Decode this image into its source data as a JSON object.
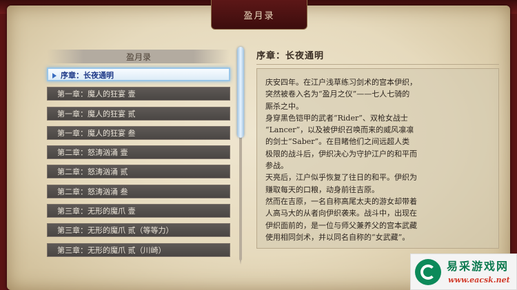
{
  "window": {
    "title": "盈月录"
  },
  "left_panel": {
    "header": "盈月录",
    "selected_index": 0,
    "chapters": [
      "序章：长夜通明",
      "第一章：魔人的狂宴  壹",
      "第一章：魔人的狂宴  贰",
      "第一章：魔人的狂宴  叁",
      "第二章：怒涛汹涌  壹",
      "第二章：怒涛汹涌  贰",
      "第二章：怒涛汹涌  叁",
      "第三章：无形的魔爪  壹",
      "第三章：无形的魔爪  贰（等等力）",
      "第三章：无形的魔爪  贰（川崎）"
    ]
  },
  "scrollbar": {
    "position": 0.0
  },
  "right_panel": {
    "title": "序章：长夜通明",
    "body": "庆安四年。在江户浅草练习剑术的宫本伊织，\n突然被卷入名为“盈月之仪”——七人七骑的\n厮杀之中。\n身穿黑色铠甲的武者“Rider”、双枪女战士\n“Lancer”，以及被伊织召唤而来的威风凛凛\n的剑士“Saber”。在目睹他们之间远超人类\n极限的战斗后，伊织决心为守护江户的和平而\n参战。\n天亮后，江户似乎恢复了往日的和平。伊织为\n赚取每天的口粮，动身前往吉原。\n然而在吉原，一名自称高尾太夫的游女却带着\n人高马大的从者向伊织袭来。战斗中，出现在\n伊织面前的，是一位与师父兼养父的宫本武藏\n使用相同剑术，并以同名自称的“女武藏”。"
  },
  "watermark": {
    "title": "易采游戏网",
    "url": "www.eacsk.net"
  }
}
